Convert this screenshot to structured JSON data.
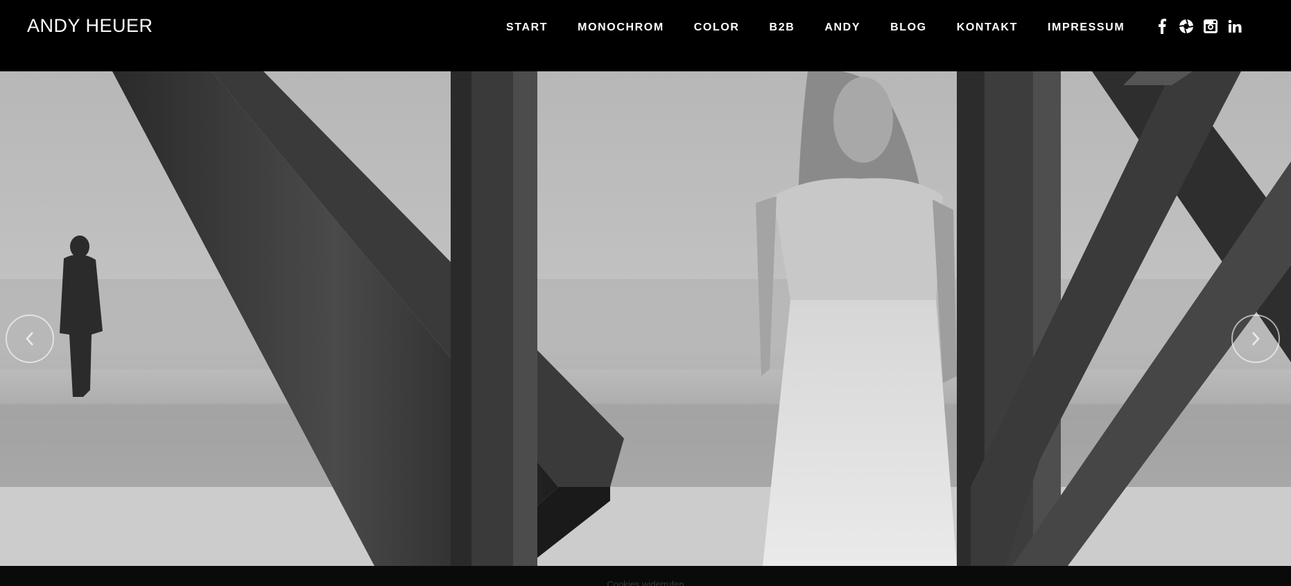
{
  "header": {
    "logo": "ANDY HEUER"
  },
  "nav": {
    "items": [
      {
        "label": "START"
      },
      {
        "label": "MONOCHROM"
      },
      {
        "label": "COLOR"
      },
      {
        "label": "B2B"
      },
      {
        "label": "ANDY"
      },
      {
        "label": "BLOG"
      },
      {
        "label": "KONTAKT"
      },
      {
        "label": "IMPRESSUM"
      }
    ]
  },
  "social": {
    "icons": [
      "facebook-icon",
      "camera-aperture-icon",
      "instagram-icon",
      "linkedin-icon"
    ]
  },
  "slider": {
    "image_description_icon": "photo-slide",
    "prev_icon": "chevron-left-icon",
    "next_icon": "chevron-right-icon"
  },
  "footer": {
    "text": "Cookies widerrufen"
  },
  "colors": {
    "header_bg": "#000000",
    "nav_text": "#ffffff",
    "footer_bg": "#0a0a0a"
  }
}
